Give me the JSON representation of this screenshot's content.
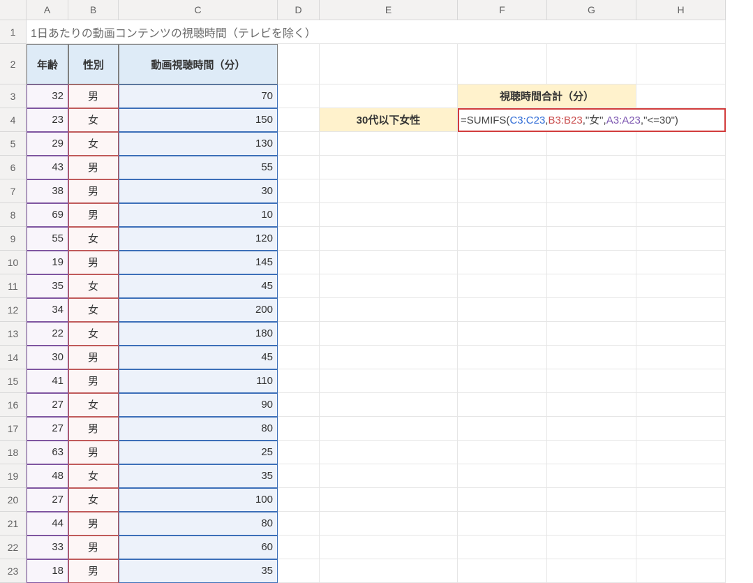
{
  "columns": [
    "",
    "A",
    "B",
    "C",
    "D",
    "E",
    "F",
    "G",
    "H"
  ],
  "row_count": 23,
  "title": "1日あたりの動画コンテンツの視聴時間（テレビを除く）",
  "headers": {
    "age": "年齢",
    "sex": "性別",
    "time": "動画視聴時間（分）"
  },
  "data_rows": [
    {
      "age": 32,
      "sex": "男",
      "time": 70
    },
    {
      "age": 23,
      "sex": "女",
      "time": 150
    },
    {
      "age": 29,
      "sex": "女",
      "time": 130
    },
    {
      "age": 43,
      "sex": "男",
      "time": 55
    },
    {
      "age": 38,
      "sex": "男",
      "time": 30
    },
    {
      "age": 69,
      "sex": "男",
      "time": 10
    },
    {
      "age": 55,
      "sex": "女",
      "time": 120
    },
    {
      "age": 19,
      "sex": "男",
      "time": 145
    },
    {
      "age": 35,
      "sex": "女",
      "time": 45
    },
    {
      "age": 34,
      "sex": "女",
      "time": 200
    },
    {
      "age": 22,
      "sex": "女",
      "time": 180
    },
    {
      "age": 30,
      "sex": "男",
      "time": 45
    },
    {
      "age": 41,
      "sex": "男",
      "time": 110
    },
    {
      "age": 27,
      "sex": "女",
      "time": 90
    },
    {
      "age": 27,
      "sex": "男",
      "time": 80
    },
    {
      "age": 63,
      "sex": "男",
      "time": 25
    },
    {
      "age": 48,
      "sex": "女",
      "time": 35
    },
    {
      "age": 27,
      "sex": "女",
      "time": 100
    },
    {
      "age": 44,
      "sex": "男",
      "time": 80
    },
    {
      "age": 33,
      "sex": "男",
      "time": 60
    },
    {
      "age": 18,
      "sex": "男",
      "time": 35
    }
  ],
  "summary": {
    "header": "視聴時間合計（分）",
    "row_label": "30代以下女性",
    "formula_plain": "=SUMIFS(C3:C23,B3:B23,\"女\",A3:A23,\"<=30\")",
    "formula_tokens": [
      {
        "t": "=SUMIFS(",
        "c": "black"
      },
      {
        "t": "C3:C23",
        "c": "blue"
      },
      {
        "t": ",",
        "c": "black"
      },
      {
        "t": "B3:B23",
        "c": "red"
      },
      {
        "t": ",\"女\",",
        "c": "black"
      },
      {
        "t": "A3:A23",
        "c": "purple"
      },
      {
        "t": ",\"<=30\")",
        "c": "black"
      }
    ]
  }
}
